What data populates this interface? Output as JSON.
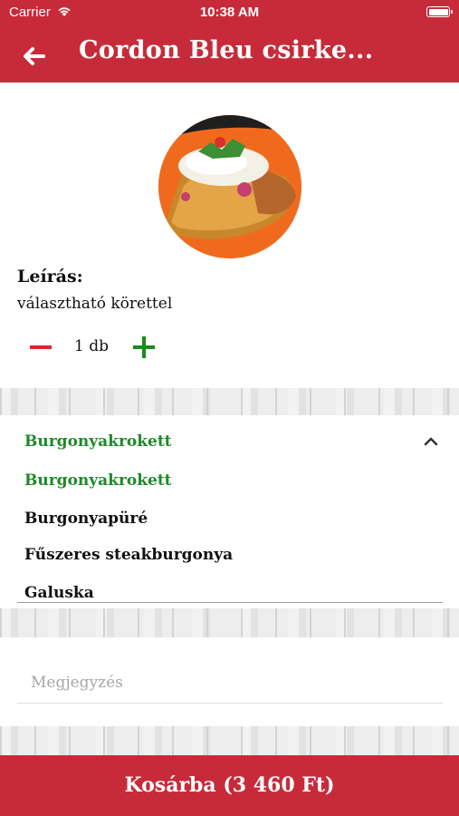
{
  "status": {
    "carrier": "Carrier",
    "time": "10:38 AM"
  },
  "header": {
    "title": "Cordon Bleu csirke..."
  },
  "product": {
    "description_label": "Leírás:",
    "description": "választható körettel",
    "quantity": "1 db"
  },
  "side_select": {
    "selected": "Burgonyakrokett",
    "options": [
      "Burgonyakrokett",
      "Burgonyapüré",
      "Fűszeres steakburgonya",
      "Galuska"
    ]
  },
  "note": {
    "placeholder": "Megjegyzés"
  },
  "cart": {
    "label": "Kosárba (3 460 Ft)"
  },
  "colors": {
    "brand_red": "#c72b3a",
    "accent_green": "#1f8a2a",
    "minus_red": "#e0262b"
  }
}
